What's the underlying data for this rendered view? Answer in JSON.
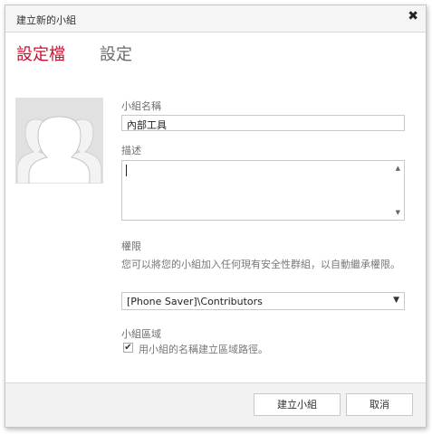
{
  "dialog": {
    "title": "建立新的小組"
  },
  "tabs": [
    {
      "label": "設定檔"
    },
    {
      "label": "設定"
    }
  ],
  "form": {
    "name_label": "小組名稱",
    "name_value": "內部工具",
    "desc_label": "描述",
    "desc_value": "",
    "perm_label": "權限",
    "perm_desc": "您可以將您的小組加入任何現有安全性群組，以自動繼承權限。",
    "perm_select": "[Phone Saver]\\Contributors",
    "area_label": "小組區域",
    "area_checkbox_label": "用小組的名稱建立區域路徑。",
    "area_checked": true
  },
  "buttons": {
    "create": "建立小組",
    "cancel": "取消"
  },
  "colors": {
    "accent": "#c8102e",
    "avatar_bg": "#e1e1e1"
  }
}
